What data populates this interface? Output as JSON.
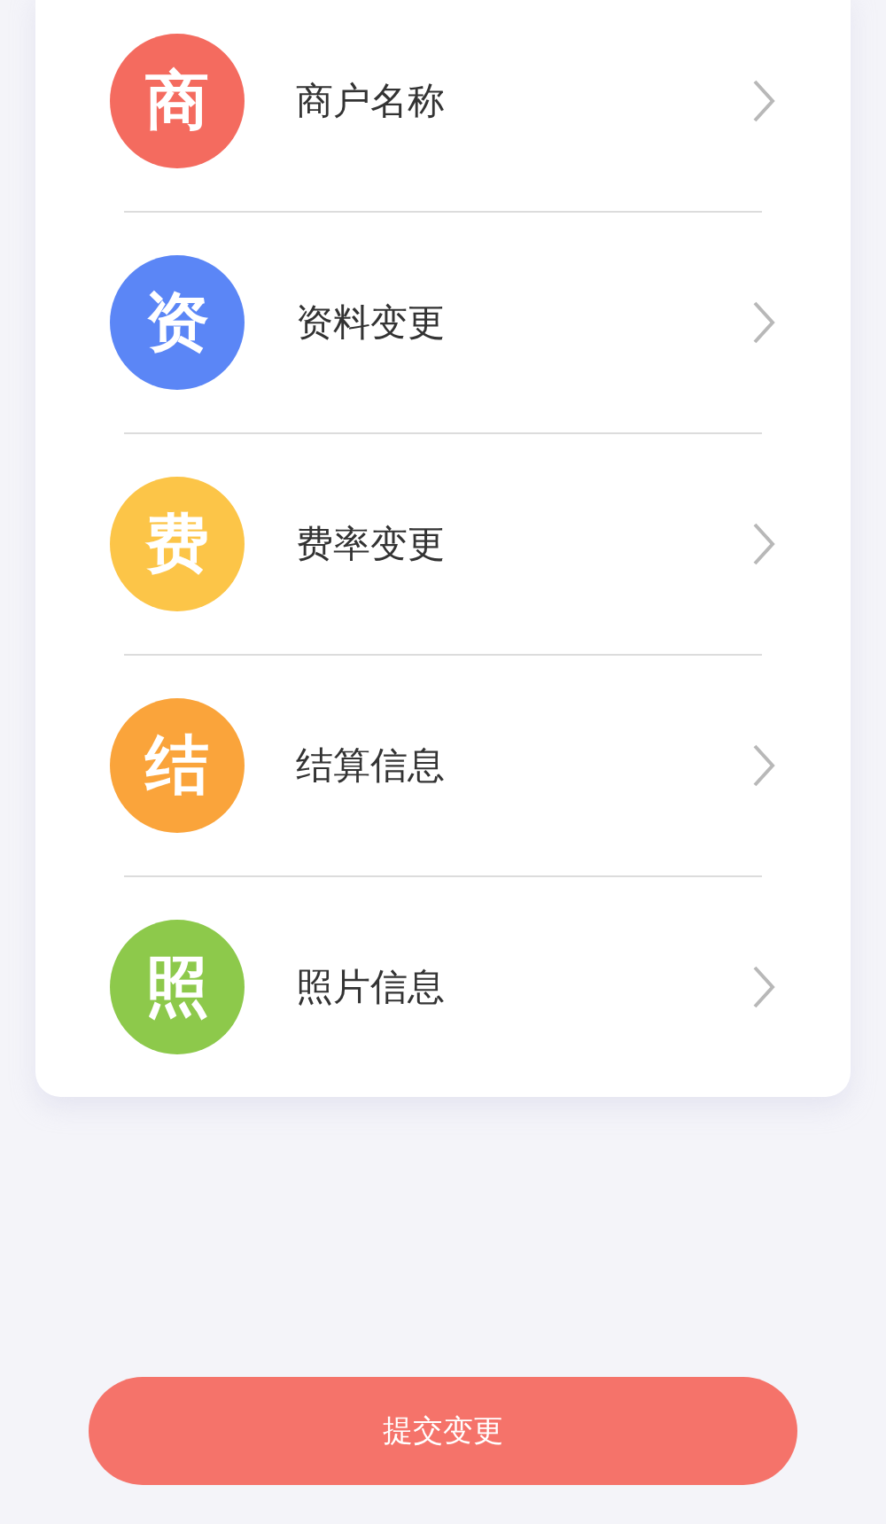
{
  "menu_items": [
    {
      "icon_text": "商",
      "label": "商户名称",
      "color": "#f46b5f"
    },
    {
      "icon_text": "资",
      "label": "资料变更",
      "color": "#5b86f6"
    },
    {
      "icon_text": "费",
      "label": "费率变更",
      "color": "#fcc548"
    },
    {
      "icon_text": "结",
      "label": "结算信息",
      "color": "#faa43b"
    },
    {
      "icon_text": "照",
      "label": "照片信息",
      "color": "#8dc94b"
    }
  ],
  "submit_button": "提交变更"
}
